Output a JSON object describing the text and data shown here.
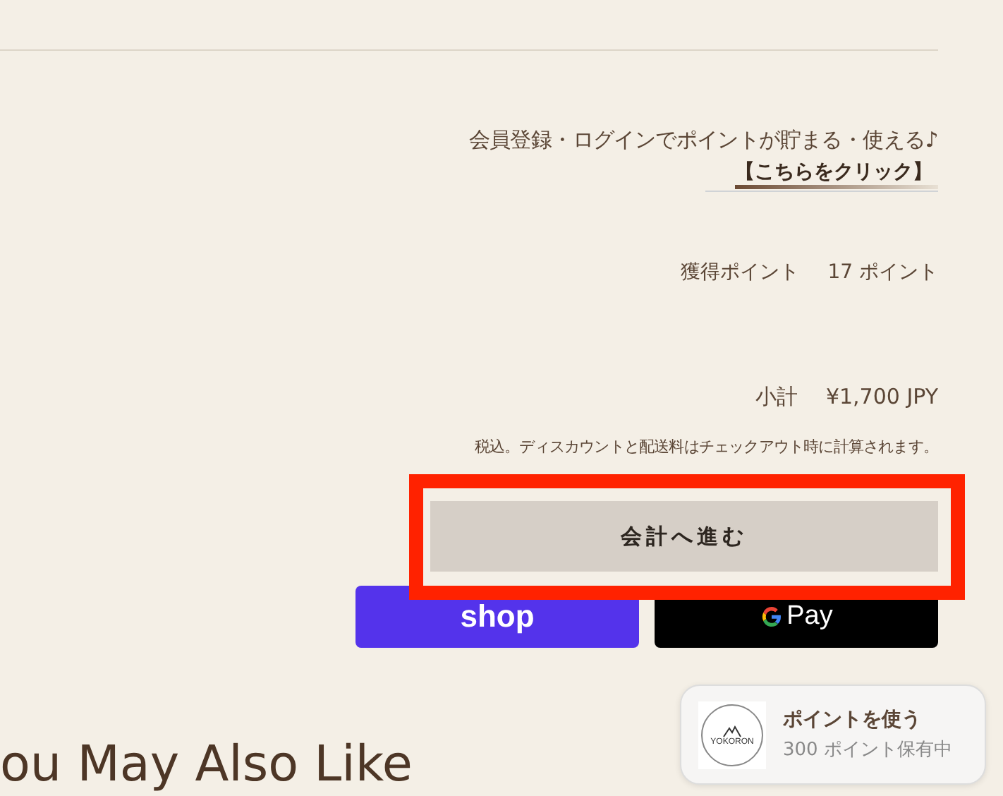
{
  "member_notice": {
    "text": "会員登録・ログインでポイントが貯まる・使える♪",
    "link": "【こちらをクリック】"
  },
  "points_earned": {
    "label": "獲得ポイント",
    "value": "17 ポイント"
  },
  "subtotal": {
    "label": "小計",
    "value": "¥1,700 JPY"
  },
  "tax_note": "税込。ディスカウントと配送料はチェックアウト時に計算されます。",
  "checkout_button": {
    "label": "会計へ進む",
    "highlighted": true
  },
  "payment_buttons": [
    {
      "kind": "shop",
      "label": "shop"
    },
    {
      "kind": "gpay",
      "label": "Pay"
    }
  ],
  "section_heading": "ou May Also Like",
  "points_popup": {
    "logo_text": "YOKORON",
    "title": "ポイントを使う",
    "subtitle": "300 ポイント保有中"
  }
}
